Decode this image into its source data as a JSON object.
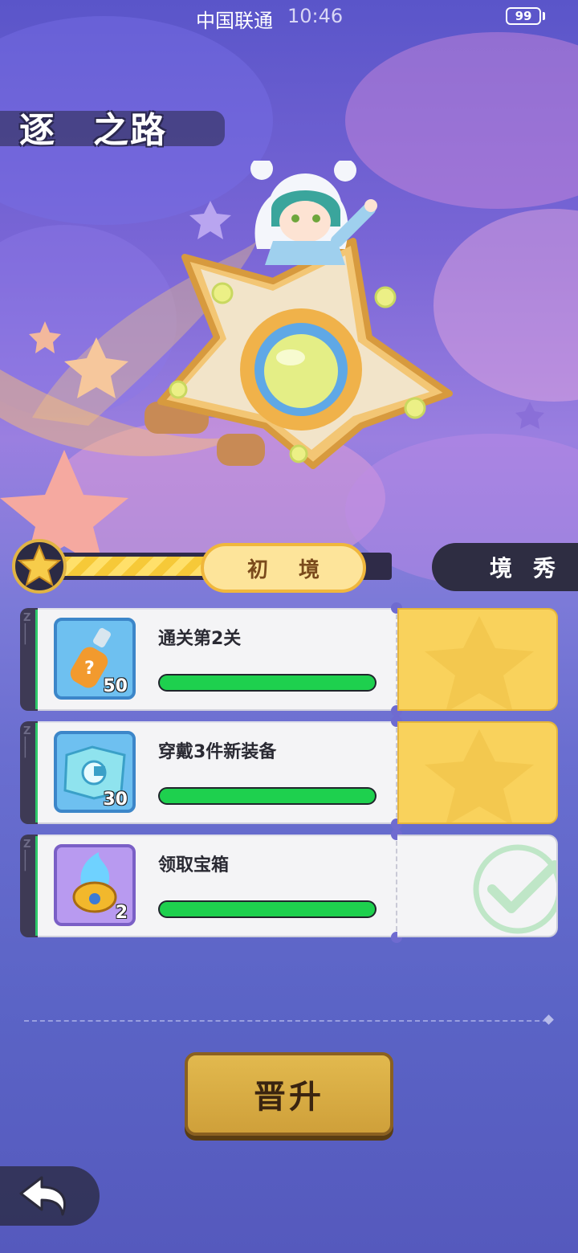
{
  "status_bar": {
    "carrier": "中国联通",
    "time": "10:46",
    "battery": "99"
  },
  "page": {
    "title": "逐　之路"
  },
  "rank": {
    "current_stage": "初境",
    "next_stage": "境秀",
    "progress": 0.92
  },
  "tasks": [
    {
      "label": "通关第2关",
      "reward_count": "50",
      "reward_icon": "drink-bottle-icon",
      "progress": 1.0,
      "status": "claimable"
    },
    {
      "label": "穿戴3件新装备",
      "reward_count": "30",
      "reward_icon": "map-scroll-icon",
      "progress": 1.0,
      "status": "claimable"
    },
    {
      "label": "领取宝箱",
      "reward_count": "2",
      "reward_icon": "blue-flame-core-icon",
      "progress": 1.0,
      "status": "completed"
    }
  ],
  "actions": {
    "promote_label": "晋升",
    "back_icon": "back-arrow-icon"
  },
  "colors": {
    "accent_yellow": "#f9d25c",
    "progress_green": "#1ed04e",
    "button_gold": "#d6a844"
  }
}
